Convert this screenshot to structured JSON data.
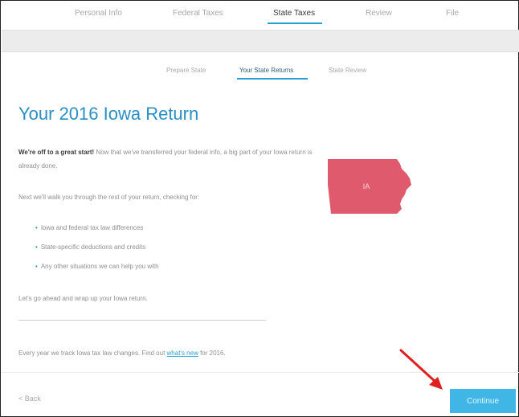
{
  "top_nav": {
    "items": [
      "Personal Info",
      "Federal Taxes",
      "State Taxes",
      "Review",
      "File"
    ],
    "active_index": 2
  },
  "sub_nav": {
    "items": [
      "Prepare State",
      "Your State Returns",
      "State Review"
    ],
    "active_index": 1
  },
  "page": {
    "title": "Your 2016 Iowa Return",
    "intro_bold": "We're off to a great start!",
    "intro_rest": " Now that we've transferred your federal info, a big part of your Iowa return is already done.",
    "next_text": "Next we'll walk you through the rest of your return, checking for:",
    "bullets": [
      "Iowa and federal tax law differences",
      "State-specific deductions and credits",
      "Any other situations we can help you with"
    ],
    "wrap_text": "Let's go ahead and wrap up your Iowa return.",
    "footer_note_pre": "Every year we track Iowa tax law changes. Find out ",
    "footer_note_link": "what's new",
    "footer_note_post": " for 2016."
  },
  "state_map": {
    "label": "IA",
    "color": "#e05a6d"
  },
  "footer": {
    "back_label": "< Back",
    "continue_label": "Continue"
  },
  "colors": {
    "accent": "#2a9fd6",
    "button": "#3fb6e6",
    "annotation_arrow": "#e02020"
  }
}
